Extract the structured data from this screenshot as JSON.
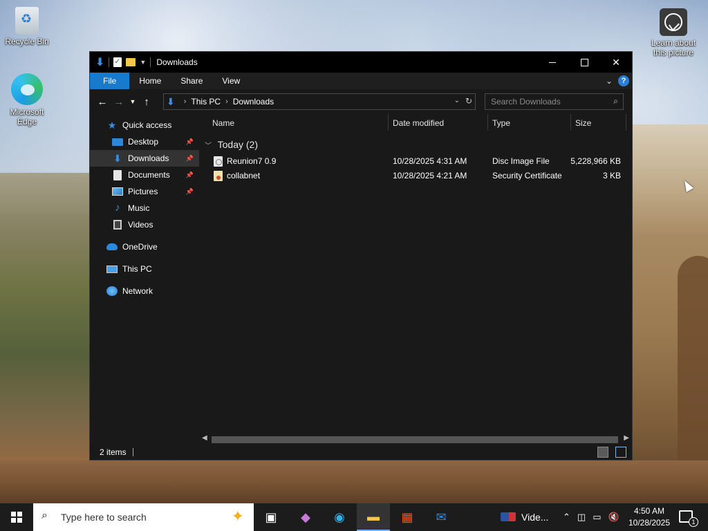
{
  "desktop": {
    "recycle_bin": "Recycle Bin",
    "edge": "Microsoft Edge",
    "learn": "Learn about this picture"
  },
  "window": {
    "title": "Downloads",
    "ribbon_tabs": [
      "File",
      "Home",
      "Share",
      "View"
    ],
    "address": {
      "root": "This PC",
      "current": "Downloads"
    },
    "search_placeholder": "Search Downloads"
  },
  "nav": {
    "quick_access": "Quick access",
    "items": [
      {
        "label": "Desktop",
        "pinned": true
      },
      {
        "label": "Downloads",
        "pinned": true,
        "selected": true
      },
      {
        "label": "Documents",
        "pinned": true
      },
      {
        "label": "Pictures",
        "pinned": true
      },
      {
        "label": "Music",
        "pinned": false
      },
      {
        "label": "Videos",
        "pinned": false
      }
    ],
    "onedrive": "OneDrive",
    "thispc": "This PC",
    "network": "Network"
  },
  "columns": {
    "name": "Name",
    "date": "Date modified",
    "type": "Type",
    "size": "Size"
  },
  "group": {
    "label": "Today (2)"
  },
  "files": [
    {
      "name": "Reunion7 0.9",
      "date": "10/28/2025 4:31 AM",
      "type": "Disc Image File",
      "size": "5,228,966 KB",
      "icon": "disc-image-icon"
    },
    {
      "name": "collabnet",
      "date": "10/28/2025 4:21 AM",
      "type": "Security Certificate",
      "size": "3 KB",
      "icon": "certificate-icon"
    }
  ],
  "status": {
    "count": "2 items"
  },
  "taskbar": {
    "search_placeholder": "Type here to search",
    "video_label": "Vide...",
    "time": "4:50 AM",
    "date": "10/28/2025",
    "notification_count": "1"
  }
}
